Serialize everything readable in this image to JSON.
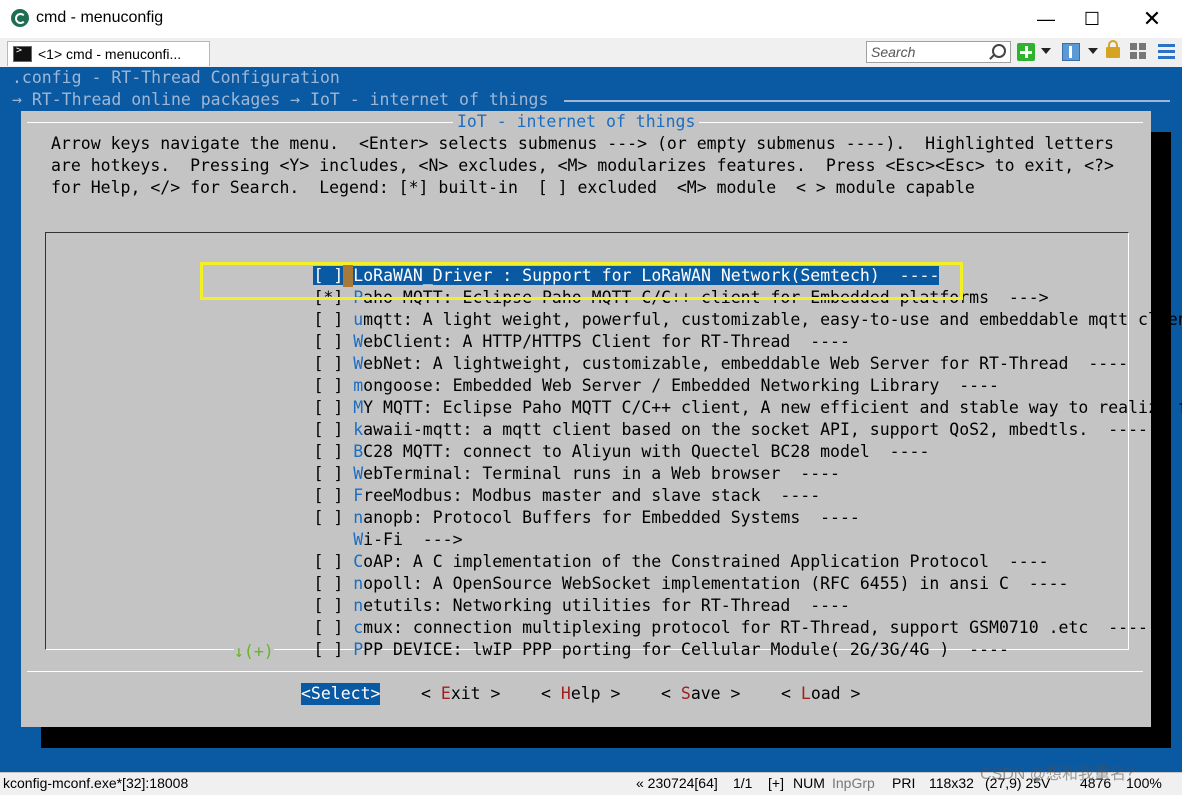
{
  "window": {
    "title": "cmd - menuconfig",
    "minimize": "—",
    "maximize": "☐",
    "close": "✕"
  },
  "toolbar": {
    "tab_label": "<1> cmd - menuconfi...",
    "search_placeholder": "Search"
  },
  "terminal": {
    "config_line": ".config - RT-Thread Configuration",
    "breadcrumb": "→ RT-Thread online packages → IoT - internet of things",
    "dialog_title": "IoT - internet of things",
    "help_lines": [
      "Arrow keys navigate the menu.  <Enter> selects submenus ---> (or empty submenus ----).  Highlighted letters",
      "are hotkeys.  Pressing <Y> includes, <N> excludes, <M> modularizes features.  Press <Esc><Esc> to exit, <?>",
      "for Help, </> for Search.  Legend: [*] built-in  [ ] excluded  <M> module  < > module capable"
    ],
    "items": [
      {
        "mark": "[ ]",
        "hot": "L",
        "rest": "oRaWAN_Driver : Support for LoRaWAN Network(Semtech)  ----"
      },
      {
        "mark": "[*]",
        "hot": "P",
        "rest": "aho MQTT: Eclipse Paho MQTT C/C++ client for Embedded platforms  --->"
      },
      {
        "mark": "[ ]",
        "hot": "u",
        "rest": "mqtt: A light weight, powerful, customizable, easy-to-use and embeddable mqtt client"
      },
      {
        "mark": "[ ]",
        "hot": "W",
        "rest": "ebClient: A HTTP/HTTPS Client for RT-Thread  ----"
      },
      {
        "mark": "[ ]",
        "hot": "W",
        "rest": "ebNet: A lightweight, customizable, embeddable Web Server for RT-Thread  ----"
      },
      {
        "mark": "[ ]",
        "hot": "m",
        "rest": "ongoose: Embedded Web Server / Embedded Networking Library  ----"
      },
      {
        "mark": "[ ]",
        "hot": "M",
        "rest": "Y MQTT: Eclipse Paho MQTT C/C++ client, A new efficient and stable way to realize fo"
      },
      {
        "mark": "[ ]",
        "hot": "k",
        "rest": "awaii-mqtt: a mqtt client based on the socket API, support QoS2, mbedtls.  ----"
      },
      {
        "mark": "[ ]",
        "hot": "B",
        "rest": "C28 MQTT: connect to Aliyun with Quectel BC28 model  ----"
      },
      {
        "mark": "[ ]",
        "hot": "W",
        "rest": "ebTerminal: Terminal runs in a Web browser  ----"
      },
      {
        "mark": "[ ]",
        "hot": "F",
        "rest": "reeModbus: Modbus master and slave stack  ----"
      },
      {
        "mark": "[ ]",
        "hot": "n",
        "rest": "anopb: Protocol Buffers for Embedded Systems  ----"
      },
      {
        "mark": "   ",
        "hot": "W",
        "rest": "i-Fi  --->"
      },
      {
        "mark": "[ ]",
        "hot": "C",
        "rest": "oAP: A C implementation of the Constrained Application Protocol  ----"
      },
      {
        "mark": "[ ]",
        "hot": "n",
        "rest": "opoll: A OpenSource WebSocket implementation (RFC 6455) in ansi C  ----"
      },
      {
        "mark": "[ ]",
        "hot": "n",
        "rest": "etutils: Networking utilities for RT-Thread  ----"
      },
      {
        "mark": "[ ]",
        "hot": "c",
        "rest": "mux: connection multiplexing protocol for RT-Thread, support GSM0710 .etc  ----"
      },
      {
        "mark": "[ ]",
        "hot": "P",
        "rest": "PP DEVICE: lwIP PPP porting for Cellular Module( 2G/3G/4G )  ----"
      }
    ],
    "more_indicator": "↓(+)",
    "buttons": {
      "select": "<Select>",
      "exit_l": "< ",
      "exit_hot": "E",
      "exit_r": "xit >",
      "help_l": "< ",
      "help_hot": "H",
      "help_r": "elp >",
      "save_l": "< ",
      "save_hot": "S",
      "save_r": "ave >",
      "load_l": "< ",
      "load_hot": "L",
      "load_r": "oad >"
    }
  },
  "statusbar": {
    "process": "kconfig-mconf.exe*[32]:18008",
    "pos": "« 230724[64]",
    "page": "1/1",
    "plus": "[+]",
    "num": "NUM",
    "inpgrp": "InpGrp",
    "pri": "PRI",
    "size": "118x32",
    "cursor": "(27,9) 25V",
    "pid": "4876",
    "zoom": "100%"
  },
  "watermark": "CSDN @想和我重名？",
  "colors": {
    "terminal_bg": "#0a5aa3",
    "dialog_bg": "#c4c4c4",
    "hotkey": "#1b6ec2",
    "annotation_box": "#f4f028"
  }
}
